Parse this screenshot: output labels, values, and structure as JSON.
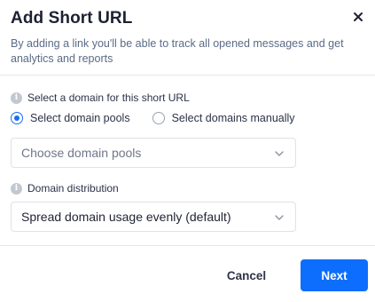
{
  "dialog": {
    "title": "Add Short URL",
    "subtitle": "By adding a link you'll be able to track all opened messages and get analytics and reports",
    "close_icon": "close-icon"
  },
  "domain_section": {
    "label": "Select a domain for this short URL",
    "info_icon": "info-icon",
    "radio_options": [
      {
        "label": "Select domain pools",
        "checked": true
      },
      {
        "label": "Select domains manually",
        "checked": false
      }
    ],
    "pool_select": {
      "placeholder": "Choose domain pools"
    }
  },
  "distribution_section": {
    "label": "Domain distribution",
    "info_icon": "info-icon",
    "select": {
      "value": "Spread domain usage evenly (default)"
    }
  },
  "footer": {
    "cancel_label": "Cancel",
    "next_label": "Next"
  },
  "colors": {
    "primary": "#0d6efd",
    "radio_checked": "#1a6cf0"
  }
}
